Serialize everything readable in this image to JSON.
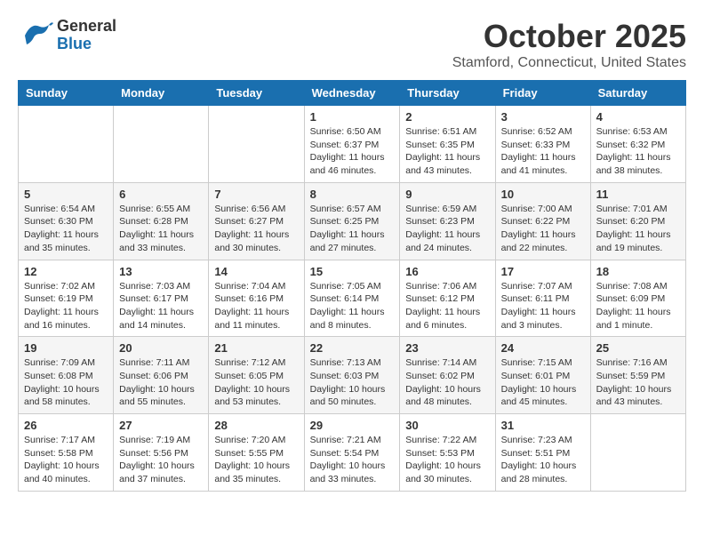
{
  "header": {
    "logo_general": "General",
    "logo_blue": "Blue",
    "month_title": "October 2025",
    "location": "Stamford, Connecticut, United States"
  },
  "days_of_week": [
    "Sunday",
    "Monday",
    "Tuesday",
    "Wednesday",
    "Thursday",
    "Friday",
    "Saturday"
  ],
  "weeks": [
    [
      {
        "day": "",
        "info": ""
      },
      {
        "day": "",
        "info": ""
      },
      {
        "day": "",
        "info": ""
      },
      {
        "day": "1",
        "info": "Sunrise: 6:50 AM\nSunset: 6:37 PM\nDaylight: 11 hours\nand 46 minutes."
      },
      {
        "day": "2",
        "info": "Sunrise: 6:51 AM\nSunset: 6:35 PM\nDaylight: 11 hours\nand 43 minutes."
      },
      {
        "day": "3",
        "info": "Sunrise: 6:52 AM\nSunset: 6:33 PM\nDaylight: 11 hours\nand 41 minutes."
      },
      {
        "day": "4",
        "info": "Sunrise: 6:53 AM\nSunset: 6:32 PM\nDaylight: 11 hours\nand 38 minutes."
      }
    ],
    [
      {
        "day": "5",
        "info": "Sunrise: 6:54 AM\nSunset: 6:30 PM\nDaylight: 11 hours\nand 35 minutes."
      },
      {
        "day": "6",
        "info": "Sunrise: 6:55 AM\nSunset: 6:28 PM\nDaylight: 11 hours\nand 33 minutes."
      },
      {
        "day": "7",
        "info": "Sunrise: 6:56 AM\nSunset: 6:27 PM\nDaylight: 11 hours\nand 30 minutes."
      },
      {
        "day": "8",
        "info": "Sunrise: 6:57 AM\nSunset: 6:25 PM\nDaylight: 11 hours\nand 27 minutes."
      },
      {
        "day": "9",
        "info": "Sunrise: 6:59 AM\nSunset: 6:23 PM\nDaylight: 11 hours\nand 24 minutes."
      },
      {
        "day": "10",
        "info": "Sunrise: 7:00 AM\nSunset: 6:22 PM\nDaylight: 11 hours\nand 22 minutes."
      },
      {
        "day": "11",
        "info": "Sunrise: 7:01 AM\nSunset: 6:20 PM\nDaylight: 11 hours\nand 19 minutes."
      }
    ],
    [
      {
        "day": "12",
        "info": "Sunrise: 7:02 AM\nSunset: 6:19 PM\nDaylight: 11 hours\nand 16 minutes."
      },
      {
        "day": "13",
        "info": "Sunrise: 7:03 AM\nSunset: 6:17 PM\nDaylight: 11 hours\nand 14 minutes."
      },
      {
        "day": "14",
        "info": "Sunrise: 7:04 AM\nSunset: 6:16 PM\nDaylight: 11 hours\nand 11 minutes."
      },
      {
        "day": "15",
        "info": "Sunrise: 7:05 AM\nSunset: 6:14 PM\nDaylight: 11 hours\nand 8 minutes."
      },
      {
        "day": "16",
        "info": "Sunrise: 7:06 AM\nSunset: 6:12 PM\nDaylight: 11 hours\nand 6 minutes."
      },
      {
        "day": "17",
        "info": "Sunrise: 7:07 AM\nSunset: 6:11 PM\nDaylight: 11 hours\nand 3 minutes."
      },
      {
        "day": "18",
        "info": "Sunrise: 7:08 AM\nSunset: 6:09 PM\nDaylight: 11 hours\nand 1 minute."
      }
    ],
    [
      {
        "day": "19",
        "info": "Sunrise: 7:09 AM\nSunset: 6:08 PM\nDaylight: 10 hours\nand 58 minutes."
      },
      {
        "day": "20",
        "info": "Sunrise: 7:11 AM\nSunset: 6:06 PM\nDaylight: 10 hours\nand 55 minutes."
      },
      {
        "day": "21",
        "info": "Sunrise: 7:12 AM\nSunset: 6:05 PM\nDaylight: 10 hours\nand 53 minutes."
      },
      {
        "day": "22",
        "info": "Sunrise: 7:13 AM\nSunset: 6:03 PM\nDaylight: 10 hours\nand 50 minutes."
      },
      {
        "day": "23",
        "info": "Sunrise: 7:14 AM\nSunset: 6:02 PM\nDaylight: 10 hours\nand 48 minutes."
      },
      {
        "day": "24",
        "info": "Sunrise: 7:15 AM\nSunset: 6:01 PM\nDaylight: 10 hours\nand 45 minutes."
      },
      {
        "day": "25",
        "info": "Sunrise: 7:16 AM\nSunset: 5:59 PM\nDaylight: 10 hours\nand 43 minutes."
      }
    ],
    [
      {
        "day": "26",
        "info": "Sunrise: 7:17 AM\nSunset: 5:58 PM\nDaylight: 10 hours\nand 40 minutes."
      },
      {
        "day": "27",
        "info": "Sunrise: 7:19 AM\nSunset: 5:56 PM\nDaylight: 10 hours\nand 37 minutes."
      },
      {
        "day": "28",
        "info": "Sunrise: 7:20 AM\nSunset: 5:55 PM\nDaylight: 10 hours\nand 35 minutes."
      },
      {
        "day": "29",
        "info": "Sunrise: 7:21 AM\nSunset: 5:54 PM\nDaylight: 10 hours\nand 33 minutes."
      },
      {
        "day": "30",
        "info": "Sunrise: 7:22 AM\nSunset: 5:53 PM\nDaylight: 10 hours\nand 30 minutes."
      },
      {
        "day": "31",
        "info": "Sunrise: 7:23 AM\nSunset: 5:51 PM\nDaylight: 10 hours\nand 28 minutes."
      },
      {
        "day": "",
        "info": ""
      }
    ]
  ]
}
